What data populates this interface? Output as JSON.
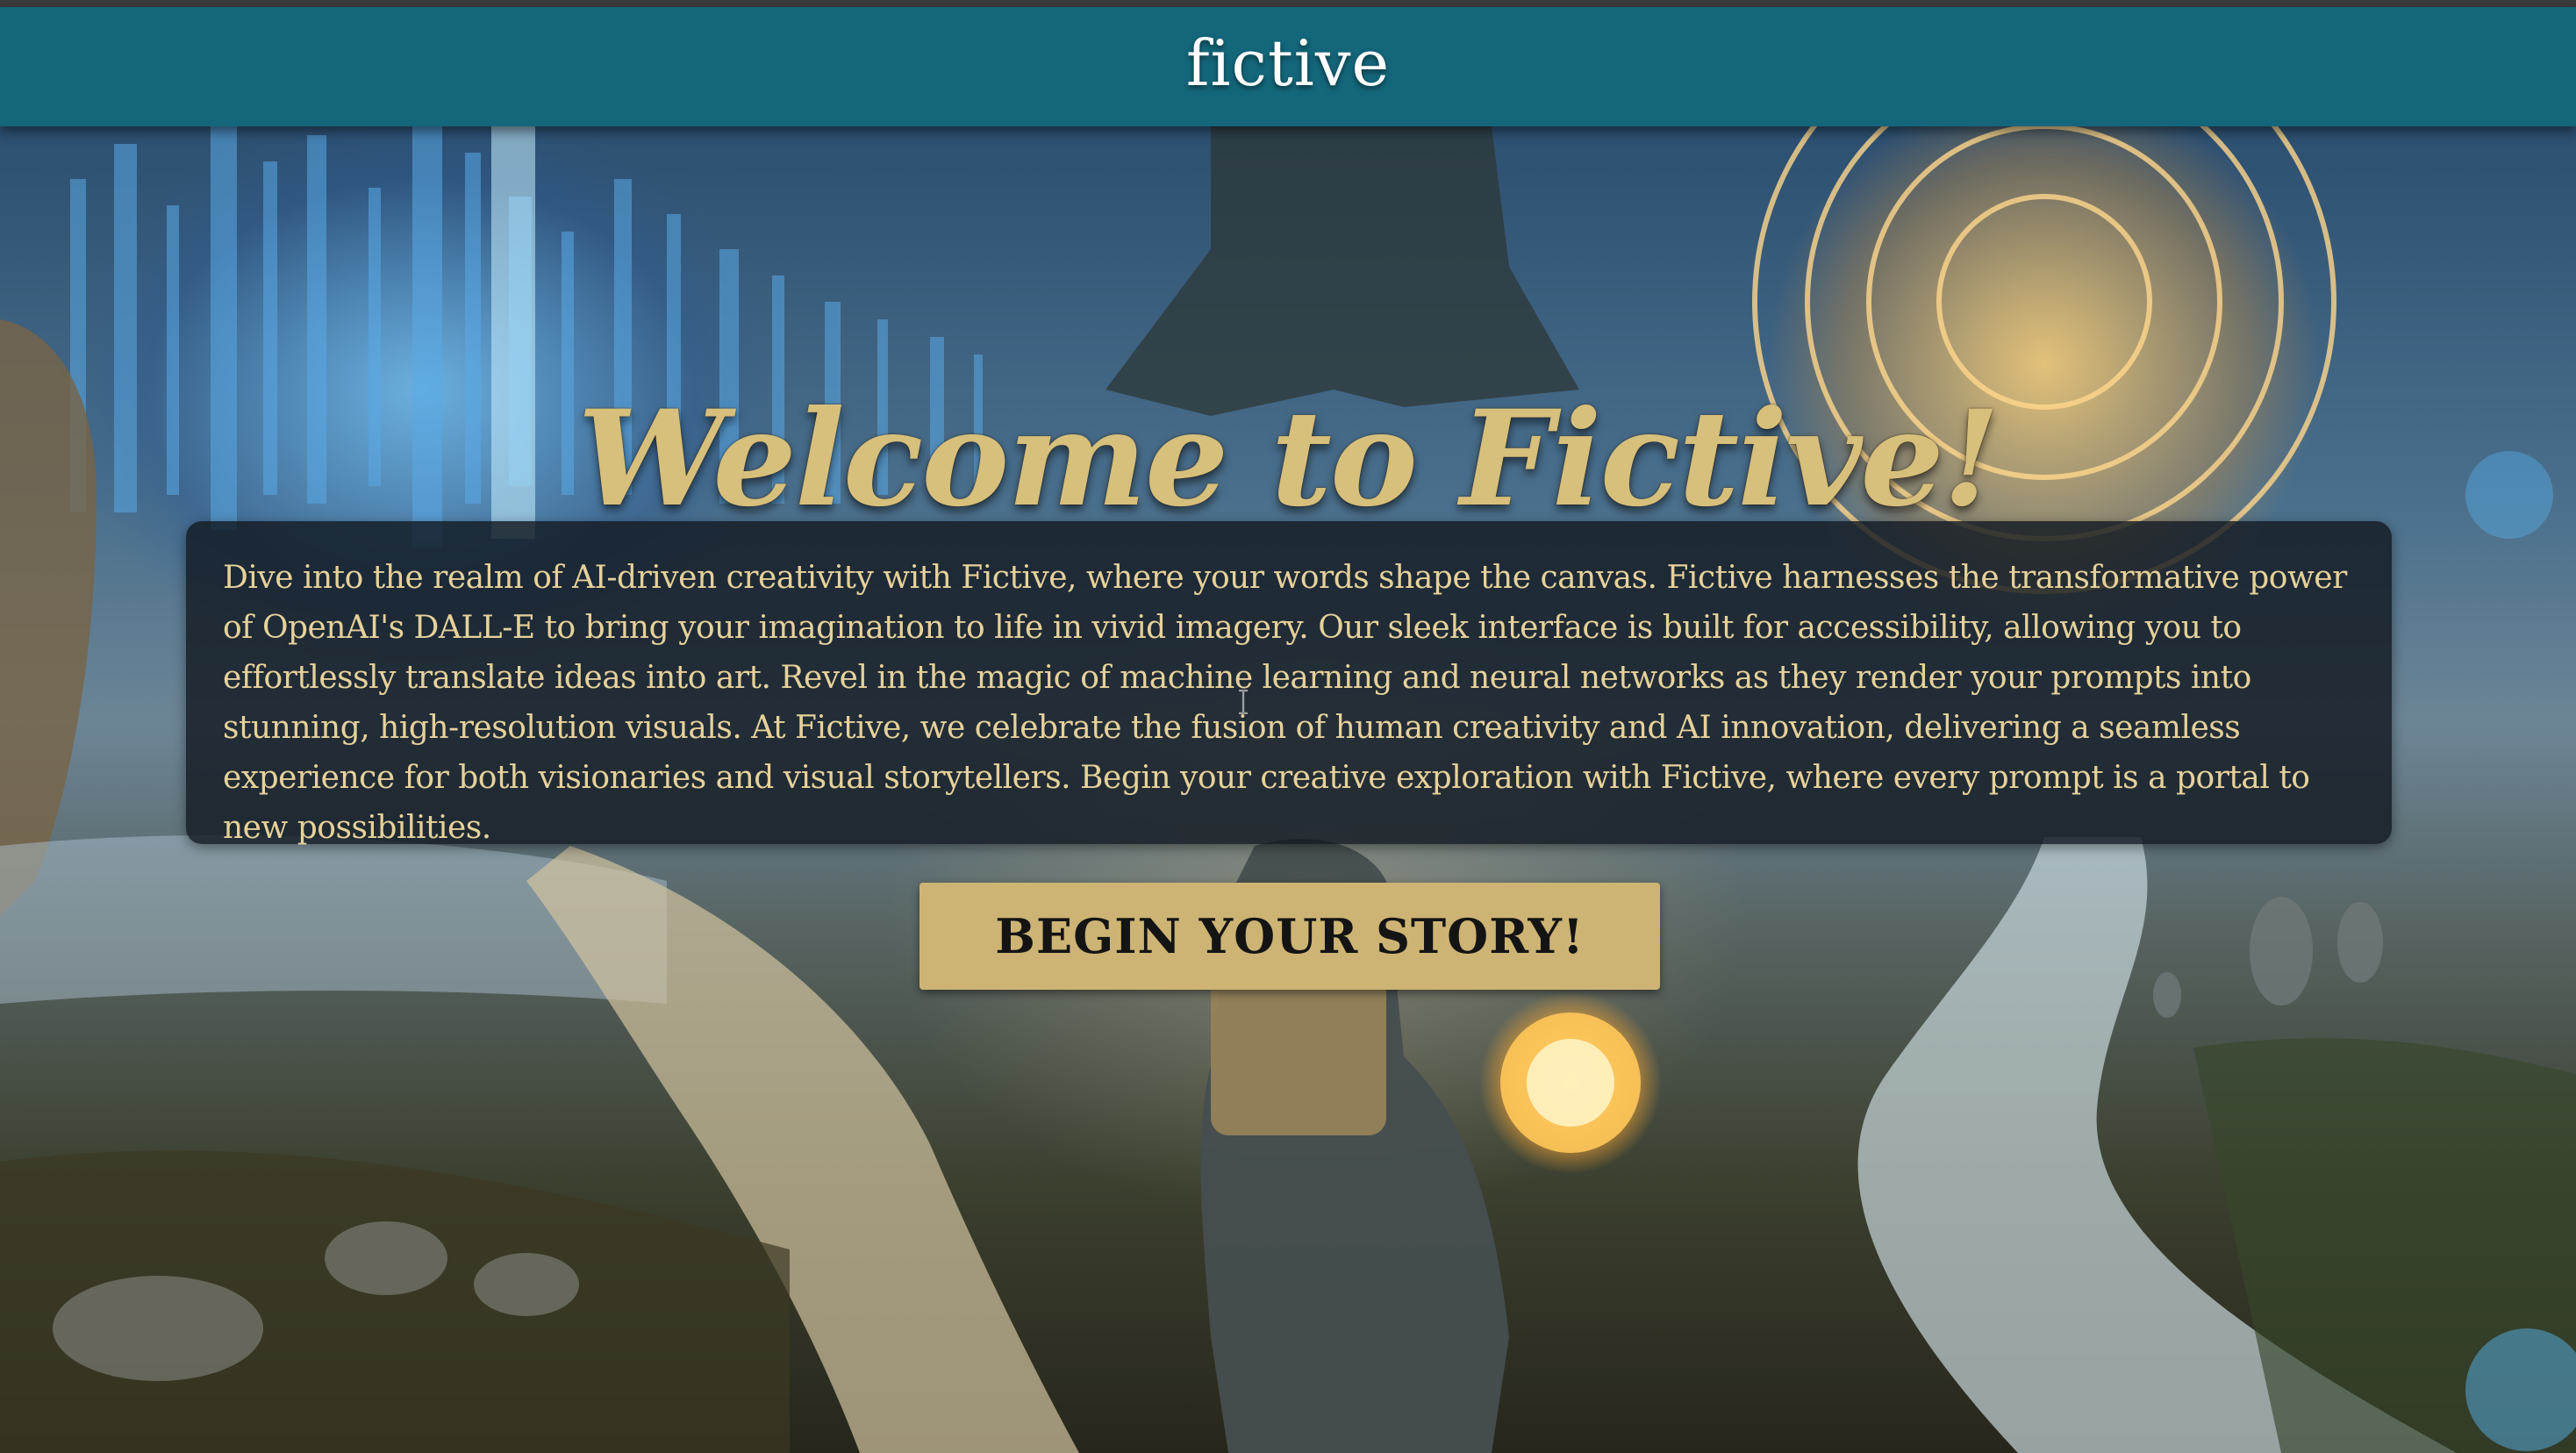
{
  "navbar": {
    "brand": "fictive"
  },
  "hero": {
    "title": "Welcome to Fictive!",
    "intro": "Dive into the realm of AI-driven creativity with Fictive, where your words shape the canvas. Fictive harnesses the transformative power of OpenAI's DALL-E to bring your imagination to life in vivid imagery. Our sleek interface is built for accessibility, allowing you to effortlessly translate ideas into art. Revel in the magic of machine learning and neural networks as they render your prompts into stunning, high-resolution visuals. At Fictive, we celebrate the fusion of human creativity and AI innovation, delivering a seamless experience for both visionaries and visual storytellers. Begin your creative exploration with Fictive, where every prompt is a portal to new possibilities.",
    "cta_label": "Begin Your Story!"
  },
  "colors": {
    "navbar": "#14667a",
    "title_gold": "#d7bf7c",
    "button_gold": "#cdb474",
    "text_panel": "#121a22",
    "panel_text": "#e6d19a"
  },
  "icons": {
    "cursor": "text-cursor-icon"
  }
}
